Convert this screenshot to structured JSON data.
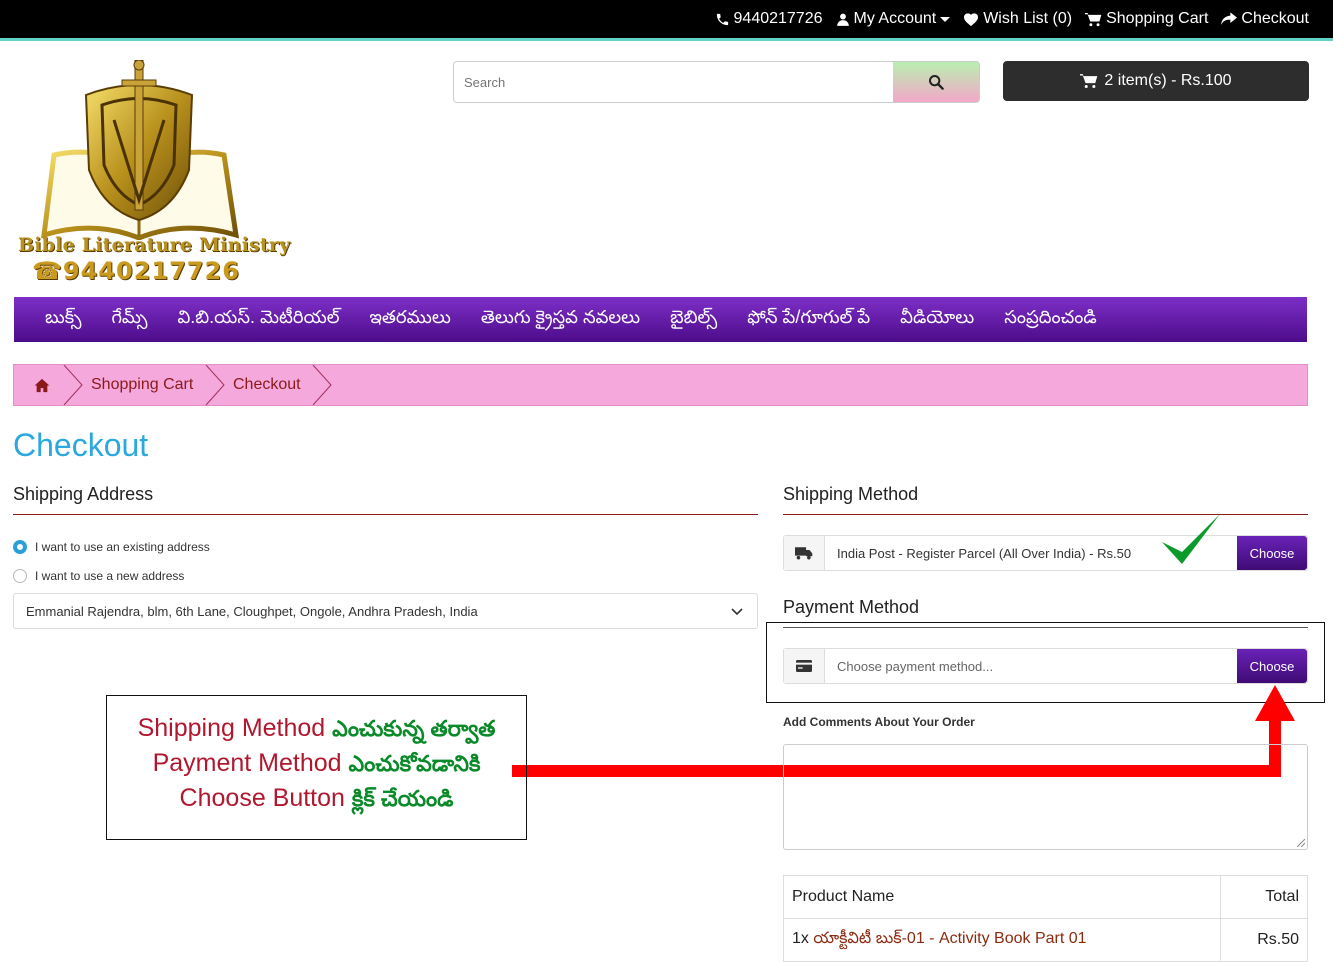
{
  "topbar": {
    "phone": "9440217726",
    "account": "My Account",
    "wishlist": "Wish List (0)",
    "cart": "Shopping Cart",
    "checkout": "Checkout"
  },
  "search": {
    "placeholder": "Search"
  },
  "cart_button": "2 item(s) - Rs.100",
  "logo": {
    "name": "Bible Literature Ministry",
    "phone": "☎9440217726"
  },
  "nav": [
    "బుక్స్",
    "గేమ్స్",
    "వి.బి.యస్. మెటీరియల్",
    "ఇతరములు",
    "తెలుగు క్రైస్తవ నవలలు",
    "బైబిల్స్",
    "ఫోన్ పే/గూగుల్ పే",
    "వీడియోలు",
    "సంప్రదించండి"
  ],
  "breadcrumb": [
    "Shopping Cart",
    "Checkout"
  ],
  "page_title": "Checkout",
  "shipping_address": {
    "heading": "Shipping Address",
    "option_existing": "I want to use an existing address",
    "option_new": "I want to use a new address",
    "selected_address": "Emmanial Rajendra, blm, 6th Lane, Cloughpet, Ongole, Andhra Pradesh, India"
  },
  "shipping_method": {
    "heading": "Shipping Method",
    "value": "India Post - Register Parcel (All Over India) - Rs.50",
    "button": "Choose"
  },
  "payment_method": {
    "heading": "Payment Method",
    "placeholder": "Choose payment method...",
    "button": "Choose"
  },
  "annotation": {
    "line1_red": "Shipping Method",
    "line1_green": "ఎంచుకున్న తర్వాత",
    "line2_red": "Payment Method",
    "line2_green": "ఎంచుకోవడానికి",
    "line3_red": "Choose Button",
    "line3_green": "క్లిక్ చేయండి"
  },
  "comments_label": "Add Comments About Your Order",
  "table": {
    "headers": [
      "Product Name",
      "Total"
    ],
    "rows": [
      {
        "qty": "1x",
        "name": "యాక్టీవిటీ బుక్-01 - Activity Book Part 01",
        "total": "Rs.50"
      }
    ]
  },
  "colors": {
    "accent": "#2aa8df",
    "nav": "#5a139e",
    "breadcrumb": "#f4a8dc",
    "arrow": "#ff0000"
  }
}
